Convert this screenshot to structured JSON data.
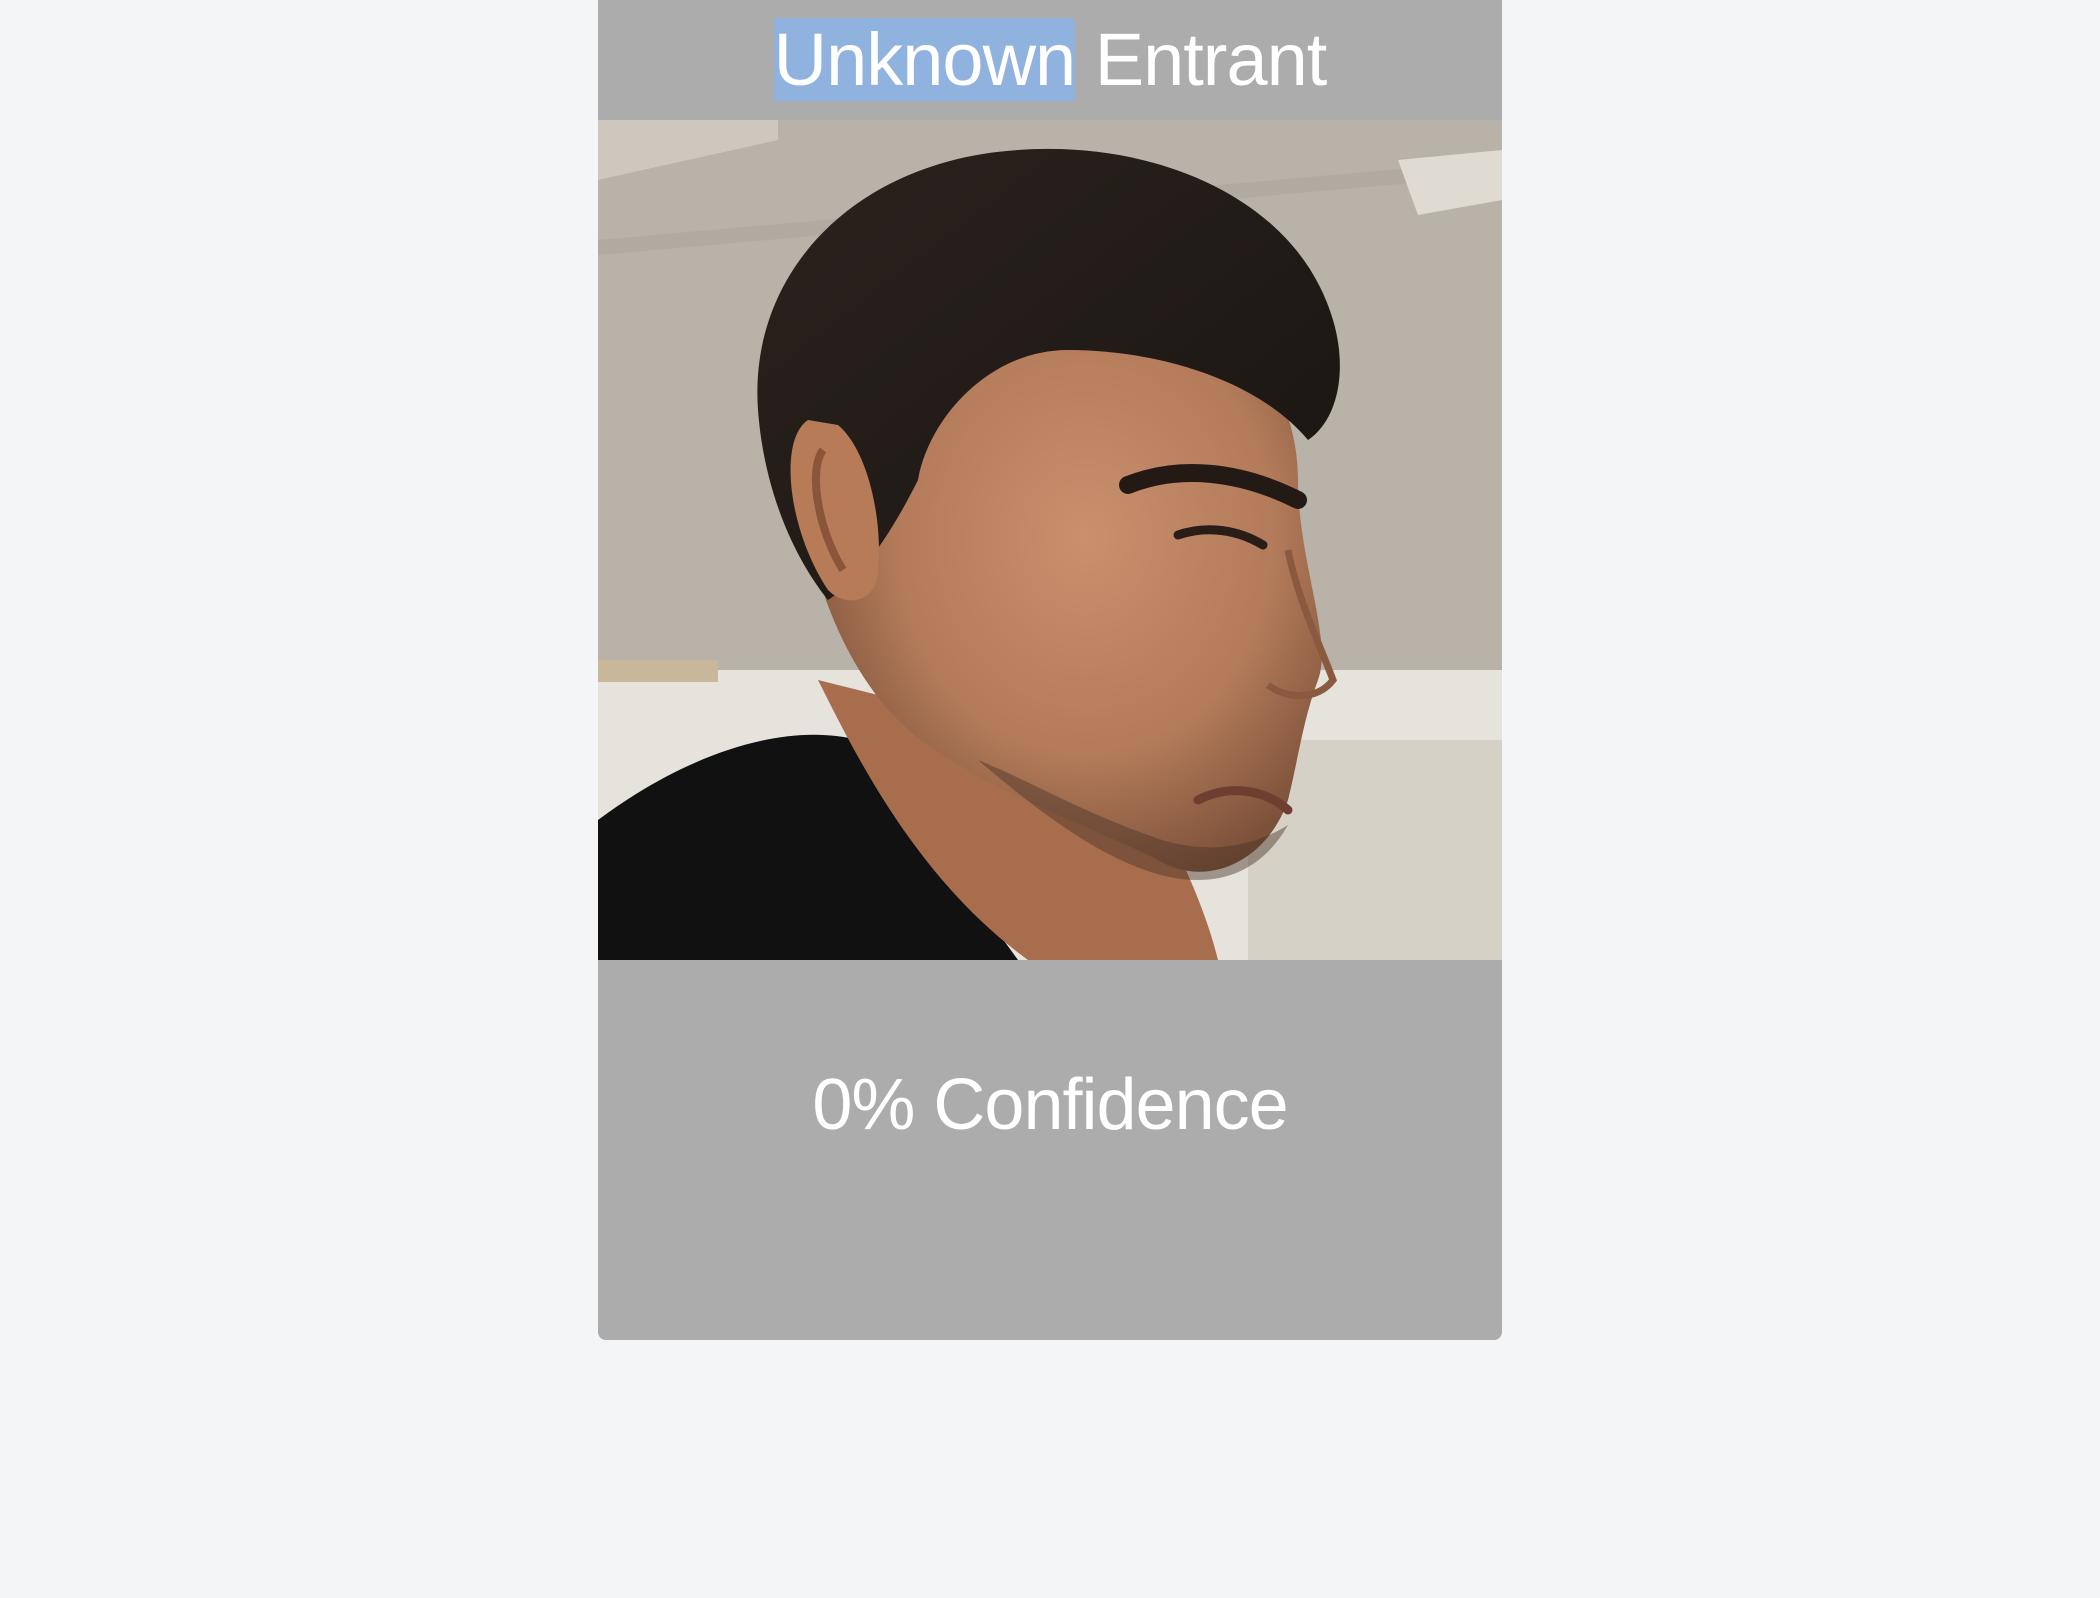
{
  "card": {
    "title_selected": "Unknown",
    "title_rest": "Entrant",
    "confidence_value": "0%",
    "confidence_label": "Confidence"
  },
  "colors": {
    "page_background": "#f4f5f7",
    "card_background": "#acacac",
    "text": "#ffffff",
    "selection_highlight": "#8fb2de"
  },
  "photo": {
    "subject": "face-crop"
  }
}
